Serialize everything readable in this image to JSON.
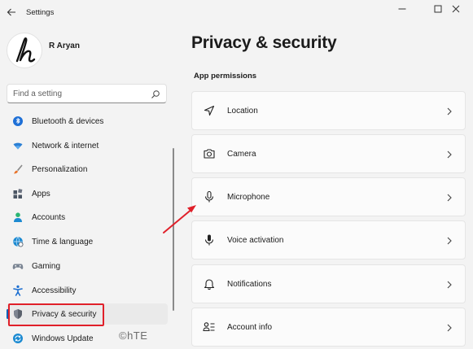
{
  "window": {
    "title": "Settings"
  },
  "profile": {
    "name": "R Aryan"
  },
  "search": {
    "placeholder": "Find a setting"
  },
  "sidebar": {
    "items": [
      {
        "label": "Bluetooth & devices",
        "icon": "bluetooth-icon"
      },
      {
        "label": "Network & internet",
        "icon": "wifi-icon"
      },
      {
        "label": "Personalization",
        "icon": "brush-icon"
      },
      {
        "label": "Apps",
        "icon": "apps-icon"
      },
      {
        "label": "Accounts",
        "icon": "person-icon"
      },
      {
        "label": "Time & language",
        "icon": "globe-clock-icon"
      },
      {
        "label": "Gaming",
        "icon": "gamepad-icon"
      },
      {
        "label": "Accessibility",
        "icon": "accessibility-icon"
      },
      {
        "label": "Privacy & security",
        "icon": "shield-icon",
        "selected": true
      },
      {
        "label": "Windows Update",
        "icon": "update-icon"
      }
    ]
  },
  "main": {
    "title": "Privacy & security",
    "section": "App permissions",
    "cards": [
      {
        "label": "Location",
        "icon": "location-icon"
      },
      {
        "label": "Camera",
        "icon": "camera-icon"
      },
      {
        "label": "Microphone",
        "icon": "microphone-icon"
      },
      {
        "label": "Voice activation",
        "icon": "voice-activation-icon"
      },
      {
        "label": "Notifications",
        "icon": "bell-icon"
      },
      {
        "label": "Account info",
        "icon": "account-info-icon"
      }
    ]
  },
  "watermark": "©hTE",
  "colors": {
    "accent": "#005fb8",
    "highlight_box": "#e0202a",
    "annotation_arrow": "#e0202a"
  }
}
